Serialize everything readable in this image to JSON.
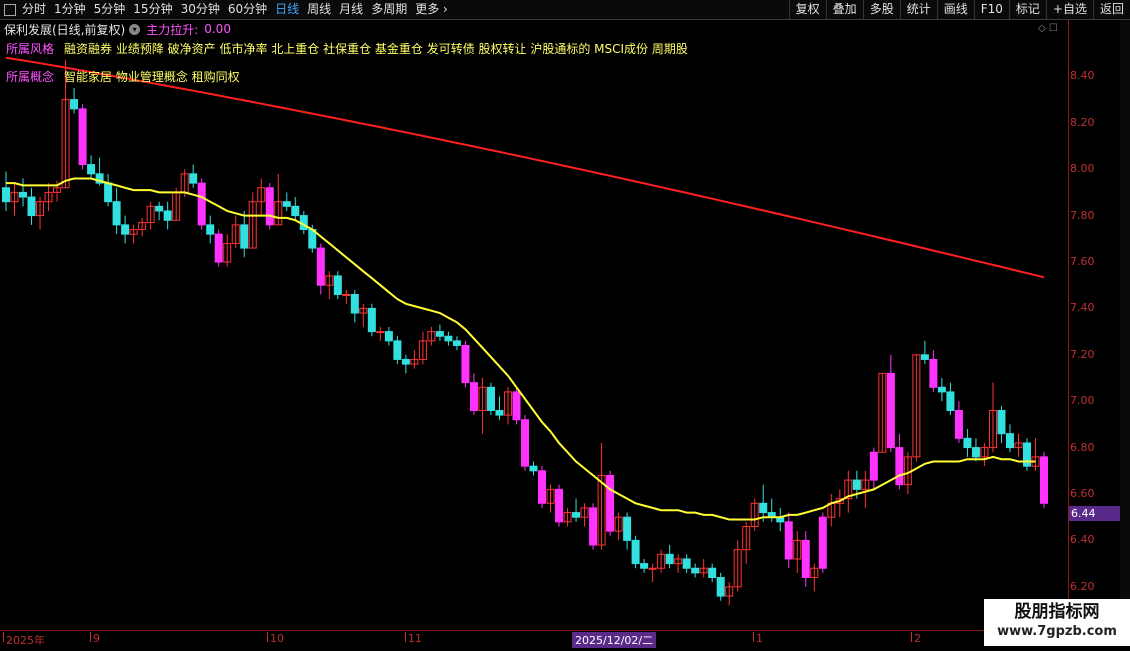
{
  "toolbar": {
    "periods": [
      "分时",
      "1分钟",
      "5分钟",
      "15分钟",
      "30分钟",
      "60分钟",
      "日线",
      "周线",
      "月线",
      "多周期",
      "更多"
    ],
    "active_period": "日线",
    "buttons": [
      "复权",
      "叠加",
      "多股",
      "统计",
      "画线",
      "F10",
      "标记",
      "+自选",
      "返回"
    ]
  },
  "header": {
    "stock_name": "保利发展(日线,前复权)",
    "indicator_name": "主力拉升:",
    "indicator_value": "0.00"
  },
  "tags": {
    "fengge_label": "所属风格",
    "fengge_text": "融资融券 业绩预降 破净资产 低市净率 北上重仓 社保重仓 基金重仓 发可转债 股权转让 沪股通标的 MSCI成份 周期股",
    "gainian_label": "所属概念",
    "gainian_text": "智能家居 物业管理概念 租购同权"
  },
  "price_axis": {
    "labels": [
      "8.40",
      "8.20",
      "8.00",
      "7.80",
      "7.60",
      "7.40",
      "7.20",
      "7.00",
      "6.80",
      "6.60",
      "6.40",
      "6.20"
    ],
    "current_price": "6.44"
  },
  "date_axis": {
    "labels": [
      "2025年",
      "9",
      "10",
      "11",
      "1",
      "2"
    ],
    "cursor_date": "2025/12/02/二"
  },
  "watermark": {
    "line1": "股朋指标网",
    "line2": "www.7gpzb.com"
  },
  "colors": {
    "up": "#ff3333",
    "down": "#33e0e0",
    "special": "#ff33ff",
    "ma_short": "#ffff33",
    "ma_long": "#ff2020",
    "axis": "#c03030",
    "accent": "#3fa9ff"
  },
  "chart_data": {
    "type": "candlestick",
    "ylim": [
      6.1,
      8.6
    ],
    "series_ohlc": [
      [
        7.92,
        7.99,
        7.82,
        7.86
      ],
      [
        7.86,
        7.94,
        7.8,
        7.9
      ],
      [
        7.9,
        7.96,
        7.84,
        7.88
      ],
      [
        7.88,
        7.92,
        7.76,
        7.8
      ],
      [
        7.8,
        7.88,
        7.74,
        7.86
      ],
      [
        7.86,
        7.94,
        7.82,
        7.9
      ],
      [
        7.9,
        7.95,
        7.86,
        7.92
      ],
      [
        7.92,
        8.47,
        7.92,
        8.3
      ],
      [
        8.3,
        8.35,
        8.24,
        8.26
      ],
      [
        8.26,
        8.28,
        8.0,
        8.02
      ],
      [
        8.02,
        8.06,
        7.96,
        7.98
      ],
      [
        7.98,
        8.05,
        7.93,
        7.94
      ],
      [
        7.94,
        7.98,
        7.84,
        7.86
      ],
      [
        7.86,
        7.92,
        7.72,
        7.76
      ],
      [
        7.76,
        7.8,
        7.68,
        7.72
      ],
      [
        7.72,
        7.76,
        7.68,
        7.74
      ],
      [
        7.74,
        7.79,
        7.71,
        7.77
      ],
      [
        7.77,
        7.86,
        7.74,
        7.84
      ],
      [
        7.84,
        7.86,
        7.78,
        7.82
      ],
      [
        7.82,
        7.86,
        7.74,
        7.78
      ],
      [
        7.78,
        7.92,
        7.78,
        7.9
      ],
      [
        7.9,
        8.0,
        7.88,
        7.98
      ],
      [
        7.98,
        8.02,
        7.92,
        7.94
      ],
      [
        7.94,
        7.96,
        7.74,
        7.76
      ],
      [
        7.76,
        7.8,
        7.68,
        7.72
      ],
      [
        7.72,
        7.74,
        7.58,
        7.6
      ],
      [
        7.6,
        7.72,
        7.58,
        7.68
      ],
      [
        7.68,
        7.8,
        7.66,
        7.76
      ],
      [
        7.76,
        7.82,
        7.62,
        7.66
      ],
      [
        7.66,
        7.9,
        7.66,
        7.86
      ],
      [
        7.86,
        7.96,
        7.8,
        7.92
      ],
      [
        7.92,
        7.94,
        7.74,
        7.76
      ],
      [
        7.76,
        7.98,
        7.76,
        7.86
      ],
      [
        7.86,
        7.9,
        7.82,
        7.84
      ],
      [
        7.84,
        7.88,
        7.78,
        7.8
      ],
      [
        7.8,
        7.82,
        7.72,
        7.74
      ],
      [
        7.74,
        7.76,
        7.64,
        7.66
      ],
      [
        7.66,
        7.68,
        7.46,
        7.5
      ],
      [
        7.5,
        7.56,
        7.44,
        7.54
      ],
      [
        7.54,
        7.56,
        7.44,
        7.46
      ],
      [
        7.46,
        7.48,
        7.42,
        7.46
      ],
      [
        7.46,
        7.48,
        7.34,
        7.38
      ],
      [
        7.38,
        7.42,
        7.32,
        7.4
      ],
      [
        7.4,
        7.42,
        7.28,
        7.3
      ],
      [
        7.3,
        7.32,
        7.26,
        7.3
      ],
      [
        7.3,
        7.32,
        7.24,
        7.26
      ],
      [
        7.26,
        7.28,
        7.16,
        7.18
      ],
      [
        7.18,
        7.2,
        7.12,
        7.16
      ],
      [
        7.16,
        7.22,
        7.14,
        7.18
      ],
      [
        7.18,
        7.3,
        7.16,
        7.26
      ],
      [
        7.26,
        7.32,
        7.24,
        7.3
      ],
      [
        7.3,
        7.33,
        7.26,
        7.28
      ],
      [
        7.28,
        7.3,
        7.24,
        7.26
      ],
      [
        7.26,
        7.28,
        7.22,
        7.24
      ],
      [
        7.24,
        7.26,
        7.06,
        7.08
      ],
      [
        7.08,
        7.12,
        6.94,
        6.96
      ],
      [
        6.96,
        7.1,
        6.86,
        7.06
      ],
      [
        7.06,
        7.08,
        6.94,
        6.96
      ],
      [
        6.96,
        7.02,
        6.92,
        6.94
      ],
      [
        6.94,
        7.06,
        6.9,
        7.04
      ],
      [
        7.04,
        7.06,
        6.9,
        6.92
      ],
      [
        6.92,
        6.94,
        6.7,
        6.72
      ],
      [
        6.72,
        6.74,
        6.68,
        6.7
      ],
      [
        6.7,
        6.72,
        6.54,
        6.56
      ],
      [
        6.56,
        6.64,
        6.52,
        6.62
      ],
      [
        6.62,
        6.64,
        6.46,
        6.48
      ],
      [
        6.48,
        6.54,
        6.46,
        6.52
      ],
      [
        6.52,
        6.58,
        6.48,
        6.5
      ],
      [
        6.5,
        6.56,
        6.46,
        6.54
      ],
      [
        6.54,
        6.56,
        6.36,
        6.38
      ],
      [
        6.38,
        6.82,
        6.36,
        6.68
      ],
      [
        6.68,
        6.7,
        6.42,
        6.44
      ],
      [
        6.44,
        6.52,
        6.4,
        6.5
      ],
      [
        6.5,
        6.52,
        6.36,
        6.4
      ],
      [
        6.4,
        6.42,
        6.28,
        6.3
      ],
      [
        6.3,
        6.32,
        6.26,
        6.28
      ],
      [
        6.28,
        6.3,
        6.22,
        6.28
      ],
      [
        6.28,
        6.36,
        6.26,
        6.34
      ],
      [
        6.34,
        6.38,
        6.28,
        6.3
      ],
      [
        6.3,
        6.34,
        6.26,
        6.32
      ],
      [
        6.32,
        6.34,
        6.26,
        6.28
      ],
      [
        6.28,
        6.3,
        6.24,
        6.26
      ],
      [
        6.26,
        6.32,
        6.24,
        6.28
      ],
      [
        6.28,
        6.3,
        6.22,
        6.24
      ],
      [
        6.24,
        6.26,
        6.14,
        6.16
      ],
      [
        6.16,
        6.22,
        6.12,
        6.2
      ],
      [
        6.2,
        6.4,
        6.18,
        6.36
      ],
      [
        6.36,
        6.48,
        6.3,
        6.46
      ],
      [
        6.46,
        6.58,
        6.44,
        6.56
      ],
      [
        6.56,
        6.64,
        6.48,
        6.52
      ],
      [
        6.52,
        6.58,
        6.48,
        6.5
      ],
      [
        6.5,
        6.54,
        6.44,
        6.48
      ],
      [
        6.48,
        6.52,
        6.28,
        6.32
      ],
      [
        6.32,
        6.44,
        6.26,
        6.4
      ],
      [
        6.4,
        6.44,
        6.2,
        6.24
      ],
      [
        6.24,
        6.3,
        6.18,
        6.28
      ],
      [
        6.28,
        6.52,
        6.26,
        6.5
      ],
      [
        6.5,
        6.6,
        6.46,
        6.56
      ],
      [
        6.56,
        6.62,
        6.5,
        6.58
      ],
      [
        6.58,
        6.7,
        6.52,
        6.66
      ],
      [
        6.66,
        6.7,
        6.58,
        6.62
      ],
      [
        6.62,
        6.7,
        6.54,
        6.66
      ],
      [
        6.66,
        6.8,
        6.62,
        6.78
      ],
      [
        6.78,
        7.12,
        6.78,
        7.12
      ],
      [
        7.12,
        7.2,
        6.78,
        6.8
      ],
      [
        6.8,
        6.86,
        6.62,
        6.64
      ],
      [
        6.64,
        6.78,
        6.6,
        6.76
      ],
      [
        6.76,
        7.2,
        6.74,
        7.2
      ],
      [
        7.2,
        7.26,
        7.16,
        7.18
      ],
      [
        7.18,
        7.22,
        7.04,
        7.06
      ],
      [
        7.06,
        7.1,
        7.0,
        7.04
      ],
      [
        7.04,
        7.08,
        6.94,
        6.96
      ],
      [
        6.96,
        7.0,
        6.82,
        6.84
      ],
      [
        6.84,
        6.88,
        6.76,
        6.8
      ],
      [
        6.8,
        6.84,
        6.74,
        6.76
      ],
      [
        6.76,
        6.82,
        6.72,
        6.8
      ],
      [
        6.8,
        7.08,
        6.78,
        6.96
      ],
      [
        6.96,
        6.98,
        6.82,
        6.86
      ],
      [
        6.86,
        6.9,
        6.78,
        6.8
      ],
      [
        6.8,
        6.86,
        6.76,
        6.82
      ],
      [
        6.82,
        6.84,
        6.7,
        6.72
      ],
      [
        6.72,
        6.84,
        6.7,
        6.76
      ],
      [
        6.76,
        6.78,
        6.54,
        6.56
      ]
    ],
    "ma_short": [
      7.94,
      7.94,
      7.93,
      7.93,
      7.93,
      7.93,
      7.93,
      7.95,
      7.96,
      7.96,
      7.96,
      7.95,
      7.94,
      7.93,
      7.92,
      7.91,
      7.91,
      7.91,
      7.9,
      7.9,
      7.9,
      7.9,
      7.89,
      7.88,
      7.86,
      7.84,
      7.82,
      7.81,
      7.8,
      7.8,
      7.8,
      7.8,
      7.79,
      7.79,
      7.78,
      7.76,
      7.74,
      7.71,
      7.68,
      7.65,
      7.62,
      7.59,
      7.56,
      7.53,
      7.5,
      7.47,
      7.44,
      7.42,
      7.41,
      7.4,
      7.39,
      7.38,
      7.36,
      7.34,
      7.31,
      7.27,
      7.23,
      7.19,
      7.15,
      7.11,
      7.06,
      7.01,
      6.96,
      6.91,
      6.87,
      6.82,
      6.78,
      6.74,
      6.71,
      6.68,
      6.65,
      6.62,
      6.6,
      6.58,
      6.56,
      6.55,
      6.54,
      6.53,
      6.53,
      6.53,
      6.52,
      6.52,
      6.51,
      6.51,
      6.5,
      6.49,
      6.49,
      6.49,
      6.49,
      6.5,
      6.5,
      6.5,
      6.51,
      6.51,
      6.52,
      6.53,
      6.54,
      6.56,
      6.57,
      6.59,
      6.6,
      6.61,
      6.62,
      6.64,
      6.66,
      6.68,
      6.69,
      6.71,
      6.73,
      6.74,
      6.74,
      6.74,
      6.74,
      6.75,
      6.75,
      6.75,
      6.76,
      6.75,
      6.75,
      6.74,
      6.74,
      6.74
    ]
  }
}
